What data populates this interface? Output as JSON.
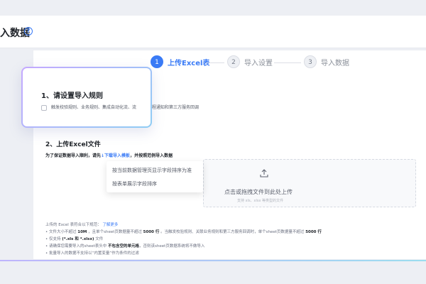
{
  "header": {
    "title": "入数据",
    "help_icon": "question-circle-icon"
  },
  "steps": [
    {
      "num": "1",
      "label": "上传Excel表",
      "active": true
    },
    {
      "num": "2",
      "label": "导入设置",
      "active": false
    },
    {
      "num": "3",
      "label": "导入数据",
      "active": false
    }
  ],
  "rule_popup": {
    "title": "1、请设置导入规则",
    "checkbox_label": "触发校验规则、业务规则、集成自动化流、流",
    "checkbox_label_rest": "程通知和第三方服务回调"
  },
  "section": {
    "title": "2、上传Excel文件",
    "hint_prefix": "为了保证数据导入顺利，请先",
    "hint_link": "下载导入模板",
    "hint_suffix": "，并按照范例导入数据"
  },
  "dropdown": {
    "items": [
      "按当前数据管理页显示字段排序为准",
      "按表单展示字段排序"
    ]
  },
  "upload": {
    "icon": "upload-icon",
    "text": "点击或拖拽文件到此处上传",
    "sub": "支持 xls、xlsx 等类型的文件"
  },
  "notes": {
    "intro": "上传的 Excel 表符合以下规范：",
    "intro_link": "了解更多",
    "line1_a": "• 文件大小不超过",
    "line1_b": "10M",
    "line1_c": "，且单个sheet页数据量不超过",
    "line1_d": "5000 行",
    "line1_e": "。当触发校验规则、关联业务规则和第三方服务回调时，单个sheet页数据量不超过",
    "line1_f": "5000 行",
    "line2_a": "• 仅支持",
    "line2_b": "(*.xls 和 *.xlsx)",
    "line2_c": "文件",
    "line3_a": "• 请确保您需要导入的sheet表头中",
    "line3_b": "不包含空的单元格",
    "line3_c": "，否则该sheet页数据系统将不做导入",
    "line4": "• 批量导入的数据不支持以“内置变量”作为条件的过滤"
  },
  "colors": {
    "accent": "#3a7bf6",
    "popup_border_from": "#c5a8ff",
    "popup_border_to": "#8ecdf4"
  }
}
